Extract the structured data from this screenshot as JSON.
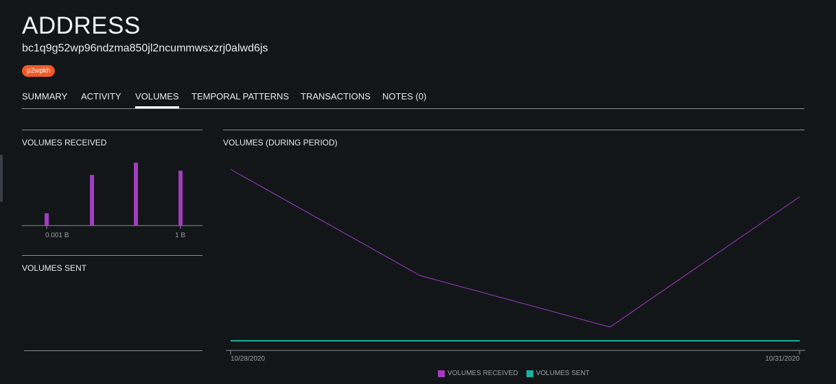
{
  "header": {
    "title": "ADDRESS",
    "address": "bc1q9g52wp96ndzma850jl2ncummwsxzrj0alwd6js",
    "badge": "p2wpkh"
  },
  "tabs": [
    {
      "label": "SUMMARY",
      "active": false
    },
    {
      "label": "ACTIVITY",
      "active": false
    },
    {
      "label": "VOLUMES",
      "active": true
    },
    {
      "label": "TEMPORAL PATTERNS",
      "active": false
    },
    {
      "label": "TRANSACTIONS",
      "active": false
    },
    {
      "label": "NOTES (0)",
      "active": false
    }
  ],
  "panels": {
    "received_title": "VOLUMES RECEIVED",
    "sent_title": "VOLUMES SENT",
    "period_title": "VOLUMES (DURING PERIOD)"
  },
  "colors": {
    "received": "#a43cc1",
    "sent": "#19b3a0",
    "badge": "#f05a28"
  },
  "chart_data": [
    {
      "type": "bar",
      "title": "VOLUMES RECEIVED",
      "values": [
        0.2,
        0.82,
        1.02,
        0.89
      ],
      "ylim": [
        0,
        1.1
      ],
      "tick_labels": [
        "0.001 B",
        "1 B"
      ]
    },
    {
      "type": "line",
      "title": "VOLUMES (DURING PERIOD)",
      "x": [
        "10/28/2020",
        "10/29/2020",
        "10/30/2020",
        "10/31/2020"
      ],
      "x_tick_labels": [
        "10/28/2020",
        "10/31/2020"
      ],
      "series": [
        {
          "name": "VOLUMES RECEIVED",
          "values": [
            1.0,
            0.38,
            0.08,
            0.84
          ]
        },
        {
          "name": "VOLUMES SENT",
          "values": [
            0,
            0,
            0,
            0
          ]
        }
      ],
      "ylim": [
        -0.02,
        1.08
      ],
      "grid": false,
      "legend": "bottom-center"
    }
  ]
}
